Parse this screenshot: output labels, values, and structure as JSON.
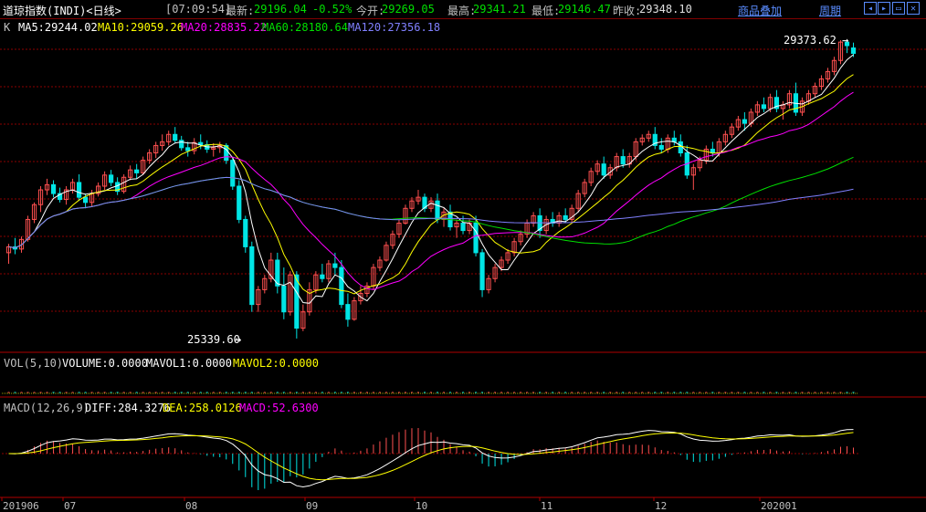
{
  "header": {
    "title": "道琼指数(INDI)<日线>",
    "time": "[07:09:54]",
    "latest_label": "最新:",
    "latest_value": "29196.04",
    "change_pct": "-0.52%",
    "open_label": "今开:",
    "open_value": "29269.05",
    "high_label": "最高:",
    "high_value": "29341.21",
    "low_label": "最低:",
    "low_value": "29146.47",
    "prev_label": "昨收:",
    "prev_value": "29348.10",
    "overlay_link": "商品叠加",
    "period_link": "周期"
  },
  "ma_legend": {
    "k": "K",
    "ma5": "MA5:29244.02",
    "ma10": "MA10:29059.26",
    "ma20": "MA20:28835.22",
    "ma60": "MA60:28180.64",
    "ma120": "MA120:27356.18"
  },
  "annotations": {
    "high": "29373.62",
    "low": "25339.60"
  },
  "vol_legend": {
    "name": "VOL(5,10)",
    "volume": "VOLUME:0.0000",
    "mavol1": "MAVOL1:0.0000",
    "mavol2": "MAVOL2:0.0000"
  },
  "macd_legend": {
    "name": "MACD(12,26,9)",
    "diff": "DIFF:284.3276",
    "dea": "DEA:258.0126",
    "macd": "MACD:52.6300"
  },
  "colors": {
    "up": "#ff5050",
    "down": "#00e5e5",
    "ma5": "#ffffff",
    "ma10": "#ffff00",
    "ma20": "#ff00ff",
    "ma60": "#00e000",
    "ma120": "#8080ff",
    "grid": "#8b0000"
  },
  "chart_data": {
    "type": "candlestick",
    "x_axis_labels": [
      "201906",
      "07",
      "08",
      "09",
      "10",
      "11",
      "12",
      "202001"
    ],
    "price_range": [
      25339.6,
      29373.62
    ],
    "candles": [
      {
        "o": 26500,
        "h": 26620,
        "l": 26350,
        "c": 26580
      },
      {
        "o": 26580,
        "h": 26700,
        "l": 26480,
        "c": 26550
      },
      {
        "o": 26550,
        "h": 26720,
        "l": 26500,
        "c": 26680
      },
      {
        "o": 26680,
        "h": 27000,
        "l": 26650,
        "c": 26950
      },
      {
        "o": 26950,
        "h": 27180,
        "l": 26900,
        "c": 27150
      },
      {
        "o": 27150,
        "h": 27400,
        "l": 27050,
        "c": 27350
      },
      {
        "o": 27350,
        "h": 27500,
        "l": 27280,
        "c": 27420
      },
      {
        "o": 27420,
        "h": 27480,
        "l": 27250,
        "c": 27300
      },
      {
        "o": 27300,
        "h": 27380,
        "l": 27180,
        "c": 27220
      },
      {
        "o": 27220,
        "h": 27400,
        "l": 27150,
        "c": 27350
      },
      {
        "o": 27350,
        "h": 27500,
        "l": 27300,
        "c": 27450
      },
      {
        "o": 27450,
        "h": 27560,
        "l": 27200,
        "c": 27250
      },
      {
        "o": 27250,
        "h": 27300,
        "l": 27100,
        "c": 27180
      },
      {
        "o": 27180,
        "h": 27350,
        "l": 27120,
        "c": 27300
      },
      {
        "o": 27300,
        "h": 27450,
        "l": 27260,
        "c": 27400
      },
      {
        "o": 27400,
        "h": 27600,
        "l": 27350,
        "c": 27550
      },
      {
        "o": 27550,
        "h": 27620,
        "l": 27400,
        "c": 27450
      },
      {
        "o": 27450,
        "h": 27520,
        "l": 27280,
        "c": 27330
      },
      {
        "o": 27330,
        "h": 27560,
        "l": 27300,
        "c": 27520
      },
      {
        "o": 27520,
        "h": 27680,
        "l": 27480,
        "c": 27620
      },
      {
        "o": 27620,
        "h": 27700,
        "l": 27500,
        "c": 27580
      },
      {
        "o": 27580,
        "h": 27800,
        "l": 27550,
        "c": 27750
      },
      {
        "o": 27750,
        "h": 27900,
        "l": 27700,
        "c": 27850
      },
      {
        "o": 27850,
        "h": 28000,
        "l": 27780,
        "c": 27950
      },
      {
        "o": 27950,
        "h": 28100,
        "l": 27880,
        "c": 28000
      },
      {
        "o": 28000,
        "h": 28150,
        "l": 27950,
        "c": 28100
      },
      {
        "o": 28100,
        "h": 28200,
        "l": 27980,
        "c": 28020
      },
      {
        "o": 28020,
        "h": 28080,
        "l": 27880,
        "c": 27920
      },
      {
        "o": 27920,
        "h": 28000,
        "l": 27800,
        "c": 27880
      },
      {
        "o": 27880,
        "h": 28050,
        "l": 27830,
        "c": 27990
      },
      {
        "o": 27990,
        "h": 28100,
        "l": 27900,
        "c": 27960
      },
      {
        "o": 27960,
        "h": 28020,
        "l": 27850,
        "c": 27900
      },
      {
        "o": 27900,
        "h": 27980,
        "l": 27800,
        "c": 27920
      },
      {
        "o": 27920,
        "h": 28000,
        "l": 27850,
        "c": 27950
      },
      {
        "o": 27950,
        "h": 27980,
        "l": 27700,
        "c": 27750
      },
      {
        "o": 27750,
        "h": 27800,
        "l": 27350,
        "c": 27400
      },
      {
        "o": 27400,
        "h": 27480,
        "l": 26900,
        "c": 26950
      },
      {
        "o": 26950,
        "h": 27000,
        "l": 26500,
        "c": 26580
      },
      {
        "o": 26580,
        "h": 26650,
        "l": 25700,
        "c": 25800
      },
      {
        "o": 25800,
        "h": 26050,
        "l": 25700,
        "c": 26000
      },
      {
        "o": 26000,
        "h": 26200,
        "l": 25950,
        "c": 26150
      },
      {
        "o": 26150,
        "h": 26500,
        "l": 26100,
        "c": 26400
      },
      {
        "o": 26400,
        "h": 26500,
        "l": 25950,
        "c": 26050
      },
      {
        "o": 26050,
        "h": 26300,
        "l": 25600,
        "c": 25700
      },
      {
        "o": 25700,
        "h": 26250,
        "l": 25650,
        "c": 26200
      },
      {
        "o": 26200,
        "h": 26250,
        "l": 25339.6,
        "c": 25480
      },
      {
        "o": 25480,
        "h": 25800,
        "l": 25440,
        "c": 25700
      },
      {
        "o": 25700,
        "h": 26100,
        "l": 25650,
        "c": 26000
      },
      {
        "o": 26000,
        "h": 26250,
        "l": 25950,
        "c": 26200
      },
      {
        "o": 26200,
        "h": 26350,
        "l": 26100,
        "c": 26150
      },
      {
        "o": 26150,
        "h": 26400,
        "l": 26100,
        "c": 26350
      },
      {
        "o": 26350,
        "h": 26500,
        "l": 26200,
        "c": 26300
      },
      {
        "o": 26300,
        "h": 26400,
        "l": 25750,
        "c": 25800
      },
      {
        "o": 25800,
        "h": 25950,
        "l": 25500,
        "c": 25600
      },
      {
        "o": 25600,
        "h": 25900,
        "l": 25580,
        "c": 25850
      },
      {
        "o": 25850,
        "h": 26050,
        "l": 25800,
        "c": 25950
      },
      {
        "o": 25950,
        "h": 26100,
        "l": 25900,
        "c": 26050
      },
      {
        "o": 26050,
        "h": 26350,
        "l": 26000,
        "c": 26300
      },
      {
        "o": 26300,
        "h": 26450,
        "l": 26250,
        "c": 26400
      },
      {
        "o": 26400,
        "h": 26650,
        "l": 26380,
        "c": 26600
      },
      {
        "o": 26600,
        "h": 26800,
        "l": 26550,
        "c": 26750
      },
      {
        "o": 26750,
        "h": 26950,
        "l": 26700,
        "c": 26900
      },
      {
        "o": 26900,
        "h": 27150,
        "l": 26880,
        "c": 27100
      },
      {
        "o": 27100,
        "h": 27250,
        "l": 27050,
        "c": 27200
      },
      {
        "o": 27200,
        "h": 27350,
        "l": 27150,
        "c": 27250
      },
      {
        "o": 27250,
        "h": 27300,
        "l": 27050,
        "c": 27100
      },
      {
        "o": 27100,
        "h": 27250,
        "l": 27050,
        "c": 27200
      },
      {
        "o": 27200,
        "h": 27300,
        "l": 26900,
        "c": 26950
      },
      {
        "o": 26950,
        "h": 27100,
        "l": 26850,
        "c": 27050
      },
      {
        "o": 27050,
        "h": 27150,
        "l": 26800,
        "c": 26850
      },
      {
        "o": 26850,
        "h": 26950,
        "l": 26700,
        "c": 26900
      },
      {
        "o": 26900,
        "h": 27000,
        "l": 26750,
        "c": 26800
      },
      {
        "o": 26800,
        "h": 26950,
        "l": 26750,
        "c": 26900
      },
      {
        "o": 26900,
        "h": 27000,
        "l": 26450,
        "c": 26500
      },
      {
        "o": 26500,
        "h": 26550,
        "l": 25900,
        "c": 26000
      },
      {
        "o": 26000,
        "h": 26200,
        "l": 25950,
        "c": 26150
      },
      {
        "o": 26150,
        "h": 26350,
        "l": 26100,
        "c": 26300
      },
      {
        "o": 26300,
        "h": 26450,
        "l": 26250,
        "c": 26400
      },
      {
        "o": 26400,
        "h": 26550,
        "l": 26350,
        "c": 26500
      },
      {
        "o": 26500,
        "h": 26700,
        "l": 26450,
        "c": 26650
      },
      {
        "o": 26650,
        "h": 26800,
        "l": 26600,
        "c": 26750
      },
      {
        "o": 26750,
        "h": 26950,
        "l": 26700,
        "c": 26900
      },
      {
        "o": 26900,
        "h": 27050,
        "l": 26850,
        "c": 27000
      },
      {
        "o": 27000,
        "h": 27100,
        "l": 26700,
        "c": 26800
      },
      {
        "o": 26800,
        "h": 27000,
        "l": 26750,
        "c": 26950
      },
      {
        "o": 26950,
        "h": 27050,
        "l": 26850,
        "c": 26900
      },
      {
        "o": 26900,
        "h": 27050,
        "l": 26850,
        "c": 27000
      },
      {
        "o": 27000,
        "h": 27100,
        "l": 26900,
        "c": 26950
      },
      {
        "o": 26950,
        "h": 27150,
        "l": 26900,
        "c": 27100
      },
      {
        "o": 27100,
        "h": 27350,
        "l": 27050,
        "c": 27300
      },
      {
        "o": 27300,
        "h": 27500,
        "l": 27250,
        "c": 27450
      },
      {
        "o": 27450,
        "h": 27650,
        "l": 27400,
        "c": 27600
      },
      {
        "o": 27600,
        "h": 27750,
        "l": 27550,
        "c": 27700
      },
      {
        "o": 27700,
        "h": 27800,
        "l": 27500,
        "c": 27550
      },
      {
        "o": 27550,
        "h": 27700,
        "l": 27500,
        "c": 27650
      },
      {
        "o": 27650,
        "h": 27850,
        "l": 27600,
        "c": 27800
      },
      {
        "o": 27800,
        "h": 27900,
        "l": 27650,
        "c": 27700
      },
      {
        "o": 27700,
        "h": 27850,
        "l": 27650,
        "c": 27800
      },
      {
        "o": 27800,
        "h": 28050,
        "l": 27750,
        "c": 28000
      },
      {
        "o": 28000,
        "h": 28100,
        "l": 27950,
        "c": 28050
      },
      {
        "o": 28050,
        "h": 28150,
        "l": 28000,
        "c": 28100
      },
      {
        "o": 28100,
        "h": 28200,
        "l": 27900,
        "c": 27950
      },
      {
        "o": 27950,
        "h": 28050,
        "l": 27850,
        "c": 27900
      },
      {
        "o": 27900,
        "h": 28100,
        "l": 27850,
        "c": 28050
      },
      {
        "o": 28050,
        "h": 28150,
        "l": 27950,
        "c": 28000
      },
      {
        "o": 28000,
        "h": 28100,
        "l": 27800,
        "c": 27850
      },
      {
        "o": 27850,
        "h": 27950,
        "l": 27500,
        "c": 27550
      },
      {
        "o": 27550,
        "h": 27700,
        "l": 27350,
        "c": 27650
      },
      {
        "o": 27650,
        "h": 27800,
        "l": 27600,
        "c": 27750
      },
      {
        "o": 27750,
        "h": 27950,
        "l": 27700,
        "c": 27900
      },
      {
        "o": 27900,
        "h": 28000,
        "l": 27800,
        "c": 27850
      },
      {
        "o": 27850,
        "h": 28050,
        "l": 27800,
        "c": 28000
      },
      {
        "o": 28000,
        "h": 28150,
        "l": 27950,
        "c": 28100
      },
      {
        "o": 28100,
        "h": 28250,
        "l": 28050,
        "c": 28200
      },
      {
        "o": 28200,
        "h": 28350,
        "l": 28150,
        "c": 28300
      },
      {
        "o": 28300,
        "h": 28400,
        "l": 28150,
        "c": 28250
      },
      {
        "o": 28250,
        "h": 28450,
        "l": 28200,
        "c": 28400
      },
      {
        "o": 28400,
        "h": 28550,
        "l": 28350,
        "c": 28500
      },
      {
        "o": 28500,
        "h": 28600,
        "l": 28400,
        "c": 28450
      },
      {
        "o": 28450,
        "h": 28650,
        "l": 28400,
        "c": 28600
      },
      {
        "o": 28600,
        "h": 28700,
        "l": 28400,
        "c": 28450
      },
      {
        "o": 28450,
        "h": 28550,
        "l": 28300,
        "c": 28500
      },
      {
        "o": 28500,
        "h": 28700,
        "l": 28450,
        "c": 28650
      },
      {
        "o": 28650,
        "h": 28800,
        "l": 28350,
        "c": 28400
      },
      {
        "o": 28400,
        "h": 28600,
        "l": 28350,
        "c": 28550
      },
      {
        "o": 28550,
        "h": 28700,
        "l": 28500,
        "c": 28650
      },
      {
        "o": 28650,
        "h": 28800,
        "l": 28600,
        "c": 28750
      },
      {
        "o": 28750,
        "h": 28900,
        "l": 28700,
        "c": 28850
      },
      {
        "o": 28850,
        "h": 29000,
        "l": 28800,
        "c": 28950
      },
      {
        "o": 28950,
        "h": 29150,
        "l": 28900,
        "c": 29100
      },
      {
        "o": 29100,
        "h": 29373.62,
        "l": 29050,
        "c": 29348.1
      },
      {
        "o": 29348.1,
        "h": 29360,
        "l": 29200,
        "c": 29300
      },
      {
        "o": 29269.05,
        "h": 29341.21,
        "l": 29146.47,
        "c": 29196.04
      }
    ],
    "macd_series": {
      "diff_label": "DIFF",
      "dea_label": "DEA",
      "macd_label": "MACD",
      "last": {
        "diff": 284.3276,
        "dea": 258.0126,
        "macd": 52.63
      }
    }
  }
}
